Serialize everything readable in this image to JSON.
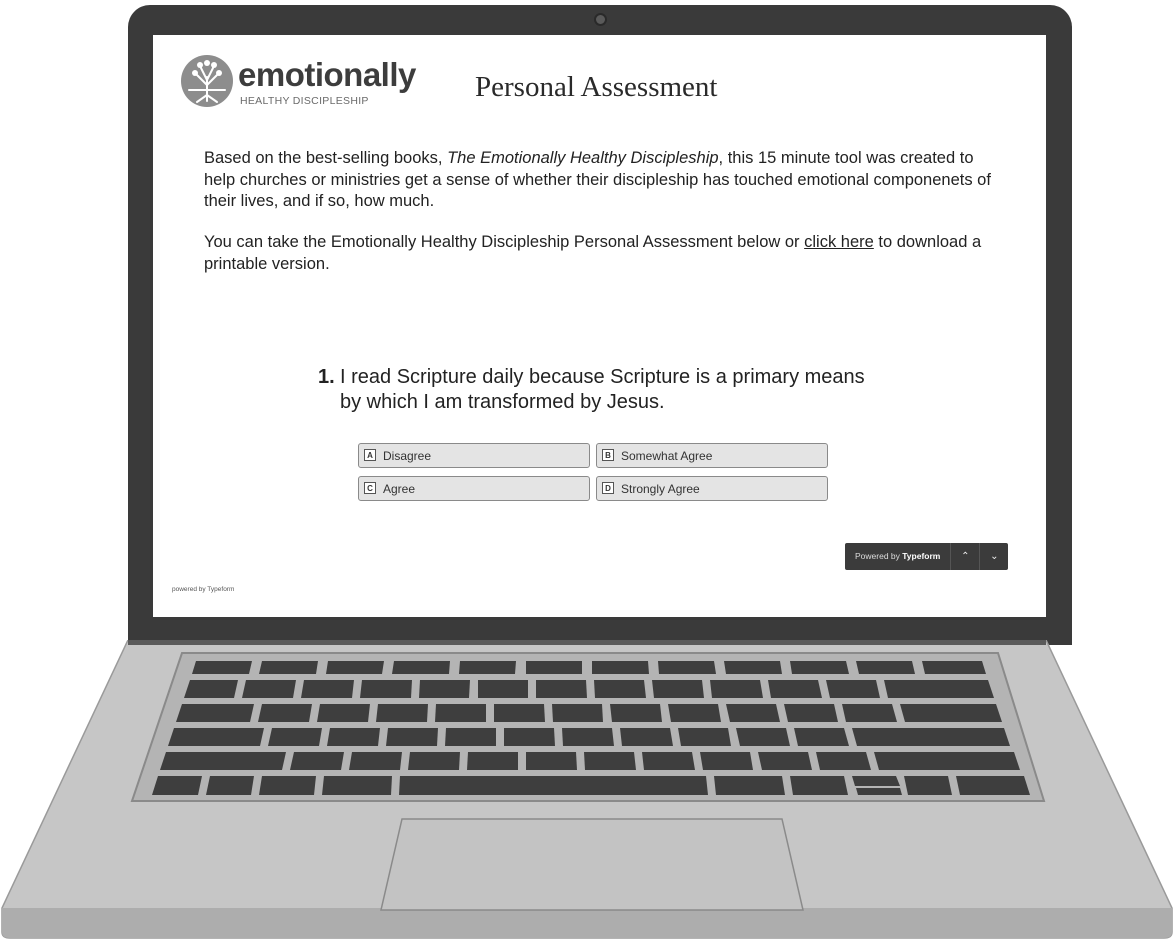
{
  "logo": {
    "word": "emotionally",
    "subtitle": "HEALTHY DISCIPLESHIP"
  },
  "page": {
    "title": "Personal Assessment",
    "intro_p1_a": "Based on the best-selling books, ",
    "intro_p1_em": "The Emotionally Healthy Discipleship",
    "intro_p1_b": ", this 15 minute tool was created to help churches or ministries get a sense of whether their discipleship has touched emotional componenets of their lives, and if so, how much.",
    "intro_p2_a": "You can take the Emotionally Healthy Discipleship Personal Assessment below or ",
    "intro_p2_link": "click here",
    "intro_p2_b": " to download a printable version."
  },
  "question": {
    "number": "1.",
    "text": "I read Scripture daily because Scripture is a primary means by which I am transformed by Jesus.",
    "choices": [
      {
        "key": "A",
        "label": "Disagree"
      },
      {
        "key": "B",
        "label": "Somewhat Agree"
      },
      {
        "key": "C",
        "label": "Agree"
      },
      {
        "key": "D",
        "label": "Strongly Agree"
      }
    ]
  },
  "footer": {
    "powered_small": "powered by Typeform",
    "powered_prefix": "Powered by ",
    "powered_brand": "Typeform",
    "up_icon": "chevron-up-icon",
    "down_icon": "chevron-down-icon"
  },
  "colors": {
    "laptop_frame": "#3a3a3a",
    "laptop_base": "#c4c4c4",
    "choice_bg": "#e4e4e4",
    "typeform_bar": "#3b3b3b"
  }
}
